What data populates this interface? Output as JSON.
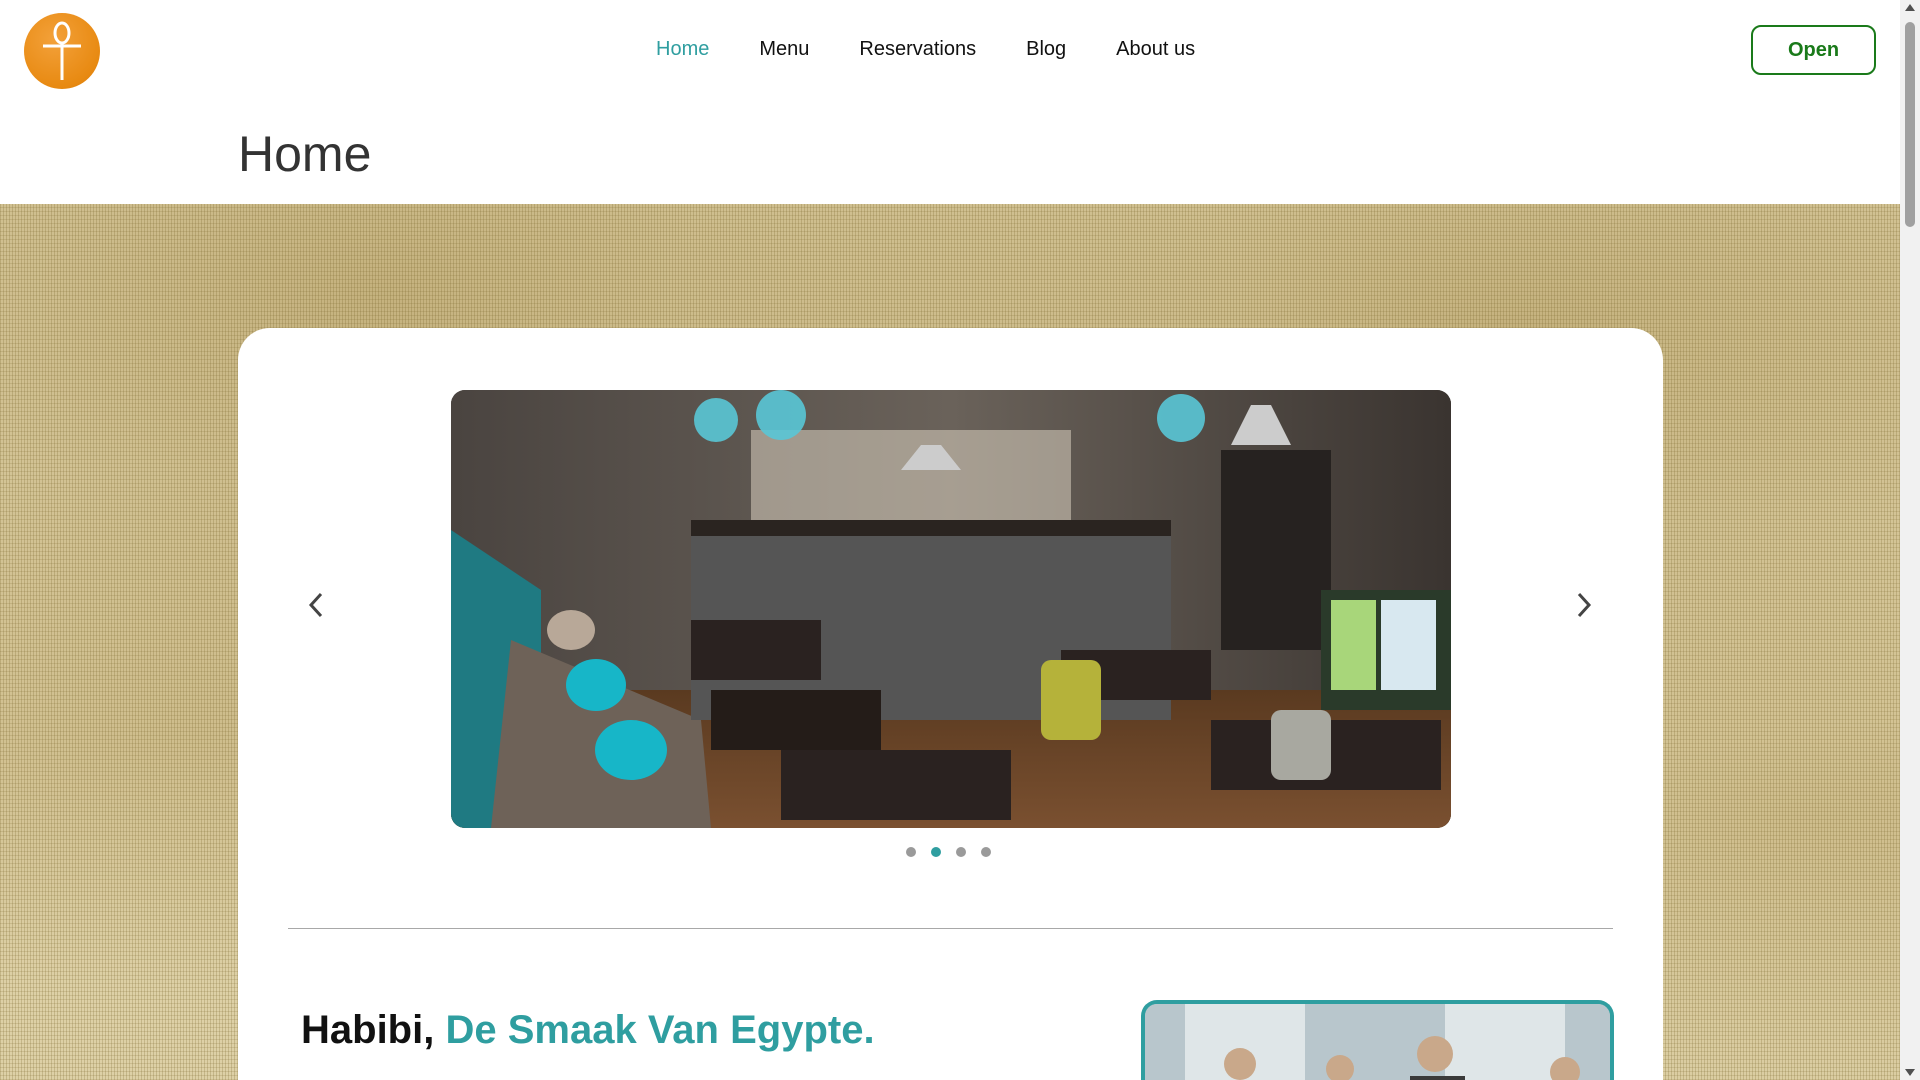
{
  "header": {
    "nav": [
      {
        "label": "Home",
        "active": true
      },
      {
        "label": "Menu",
        "active": false
      },
      {
        "label": "Reservations",
        "active": false
      },
      {
        "label": "Blog",
        "active": false
      },
      {
        "label": "About us",
        "active": false
      }
    ],
    "open_label": "Open",
    "logo_icon": "ankh-icon"
  },
  "page": {
    "title": "Home"
  },
  "carousel": {
    "slide_count": 4,
    "active_index": 1,
    "prev_icon": "chevron-left-icon",
    "next_icon": "chevron-right-icon"
  },
  "intro": {
    "heading_lead": "Habibi,",
    "heading_accent": "De Smaak Van Egypte."
  },
  "colors": {
    "accent": "#2f9ea0",
    "logo": "#e88a12",
    "open_button": "#1a7a1a"
  }
}
